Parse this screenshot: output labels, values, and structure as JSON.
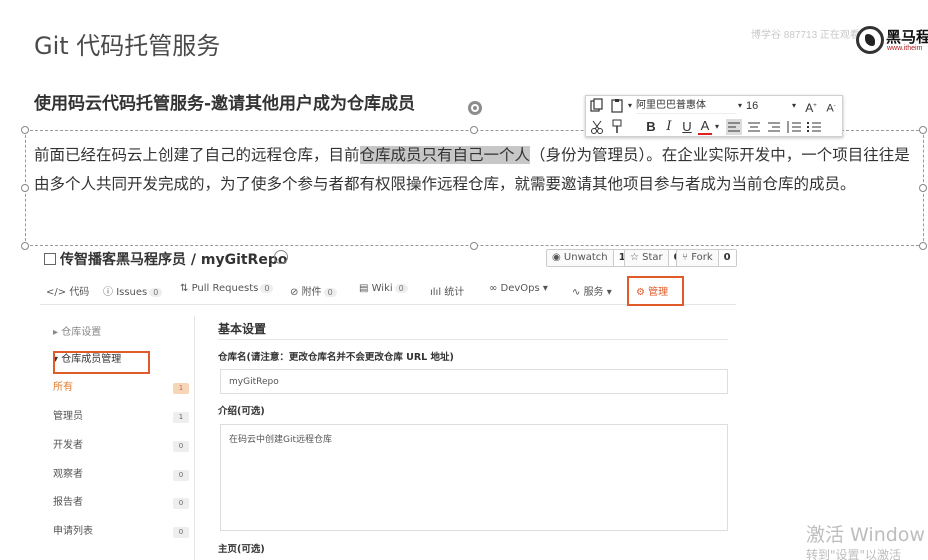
{
  "slide": {
    "title": "Git 代码托管服务",
    "subtitle": "使用码云代码托管服务-邀请其他用户成为仓库成员",
    "paragraph": {
      "before": "前面已经在码云上创建了自己的远程仓库，目前",
      "highlighted": "仓库成员只有自己一个人",
      "after": "（身份为管理员）。在企业实际开发中，一个项目往往是由多个人共同开发完成的，为了使多个参与者都有权限操作远程仓库，就需要邀请其他项目参与者成为当前仓库的成员。"
    }
  },
  "watermark": "博学谷 887713 正在观看",
  "logo": {
    "brand": "黑马程",
    "url": "www.itheim"
  },
  "mini_toolbar": {
    "font_name": "阿里巴巴普惠体",
    "font_size": "16",
    "bold": "B",
    "italic": "I",
    "underline": "U",
    "font_color": "A",
    "grow": "A",
    "shrink": "A"
  },
  "repo": {
    "title": "传智播客黑马程序员 / myGitRepo",
    "watch_label": "Unwatch",
    "watch_count": "1",
    "star_label": "Star",
    "star_count": "0",
    "fork_label": "Fork",
    "fork_count": "0",
    "tabs": [
      {
        "label": "代码"
      },
      {
        "label": "Issues",
        "count": "0"
      },
      {
        "label": "Pull Requests",
        "count": "0"
      },
      {
        "label": "附件",
        "count": "0"
      },
      {
        "label": "Wiki",
        "count": "0"
      },
      {
        "label": "统计"
      },
      {
        "label": "DevOps ▾"
      },
      {
        "label": "服务 ▾"
      },
      {
        "label": "管理"
      }
    ],
    "sidebar": {
      "settings_label": "仓库设置",
      "members_label": "仓库成员管理",
      "items": [
        {
          "label": "所有",
          "count": "1"
        },
        {
          "label": "管理员",
          "count": "1"
        },
        {
          "label": "开发者",
          "count": "0"
        },
        {
          "label": "观察者",
          "count": "0"
        },
        {
          "label": "报告者",
          "count": "0"
        },
        {
          "label": "申请列表",
          "count": "0"
        }
      ]
    },
    "main": {
      "heading": "基本设置",
      "name_label": "仓库名(请注意：更改仓库名并不会更改仓库 URL 地址)",
      "name_value": "myGitRepo",
      "intro_label": "介绍(可选)",
      "intro_value": "在码云中创建Git远程仓库",
      "homepage_label": "主页(可选)"
    }
  },
  "windows_activation": {
    "line1": "激活 Window",
    "line2": "转到\"设置\"以激活"
  },
  "colors": {
    "accent": "#e05a2a",
    "highlight": "#c7c7c7",
    "text": "#333333"
  }
}
